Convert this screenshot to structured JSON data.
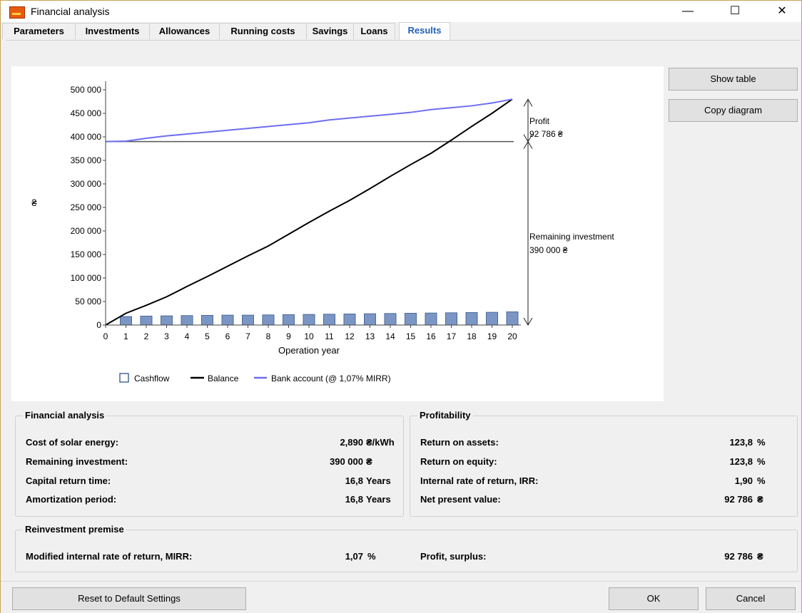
{
  "window": {
    "title": "Financial analysis",
    "minimize": "—",
    "maximize": "☐",
    "close": "✕"
  },
  "tabs": [
    {
      "label": "Parameters"
    },
    {
      "label": "Investments"
    },
    {
      "label": "Allowances"
    },
    {
      "label": "Running costs"
    },
    {
      "label": "Savings"
    },
    {
      "label": "Loans"
    },
    {
      "label": "Results"
    }
  ],
  "buttons": {
    "show_table": "Show table",
    "copy_diagram": "Copy diagram",
    "reset": "Reset to Default Settings",
    "ok": "OK",
    "cancel": "Cancel"
  },
  "chart_data": {
    "type": "bar",
    "xlabel": "Operation year",
    "ylabel": "₴",
    "x": [
      0,
      1,
      2,
      3,
      4,
      5,
      6,
      7,
      8,
      9,
      10,
      11,
      12,
      13,
      14,
      15,
      16,
      17,
      18,
      19,
      20
    ],
    "ylim": [
      0,
      500000
    ],
    "yticks": [
      0,
      50000,
      100000,
      150000,
      200000,
      250000,
      300000,
      350000,
      400000,
      450000,
      500000
    ],
    "ytick_labels": [
      "0",
      "50 000",
      "100 000",
      "150 000",
      "200 000",
      "250 000",
      "300 000",
      "350 000",
      "400 000",
      "450 000",
      "500 000"
    ],
    "series": [
      {
        "name": "Cashflow",
        "type": "bar",
        "color": "#7b96c4",
        "values": [
          null,
          18000,
          19000,
          19500,
          20000,
          20500,
          21000,
          21000,
          21500,
          22000,
          22500,
          23000,
          23500,
          24000,
          24500,
          25000,
          25500,
          26000,
          26500,
          27000,
          28000
        ]
      },
      {
        "name": "Balance",
        "type": "line",
        "color": "#000000",
        "values": [
          0,
          25000,
          42000,
          60000,
          82000,
          103000,
          125000,
          147000,
          168000,
          193000,
          218000,
          242000,
          265000,
          290000,
          316000,
          341000,
          365000,
          393000,
          422000,
          450000,
          480000
        ]
      },
      {
        "name": "Bank account (@ 1,07% MIRR)",
        "type": "line",
        "color": "#6e6ef0",
        "values": [
          390000,
          391000,
          397000,
          402000,
          406000,
          410000,
          414000,
          418000,
          422000,
          426000,
          430000,
          436000,
          440000,
          444000,
          448000,
          452000,
          458000,
          462000,
          466000,
          472000,
          480000
        ]
      }
    ],
    "reference_line": 390000,
    "annotations": [
      {
        "label": "Profit",
        "value": "92 786 ₴"
      },
      {
        "label": "Remaining investment",
        "value": "390 000 ₴"
      }
    ]
  },
  "financial_analysis": {
    "title": "Financial analysis",
    "rows": [
      {
        "label": "Cost of solar energy:",
        "value": "2,890",
        "unit": "₴/kWh"
      },
      {
        "label": "Remaining investment:",
        "value": "390 000",
        "unit": "₴"
      },
      {
        "label": "Capital return time:",
        "value": "16,8",
        "unit": "Years"
      },
      {
        "label": "Amortization period:",
        "value": "16,8",
        "unit": "Years"
      }
    ]
  },
  "profitability": {
    "title": "Profitability",
    "rows": [
      {
        "label": "Return on assets:",
        "value": "123,8",
        "unit": "%"
      },
      {
        "label": "Return on equity:",
        "value": "123,8",
        "unit": "%"
      },
      {
        "label": "Internal rate of return, IRR:",
        "value": "1,90",
        "unit": "%"
      },
      {
        "label": "Net present value:",
        "value": "92 786",
        "unit": "₴"
      }
    ]
  },
  "reinvestment": {
    "title": "Reinvestment premise",
    "mirr_label": "Modified internal rate of return, MIRR:",
    "mirr_value": "1,07",
    "mirr_unit": "%",
    "profit_label": "Profit, surplus:",
    "profit_value": "92 786",
    "profit_unit": "₴"
  }
}
